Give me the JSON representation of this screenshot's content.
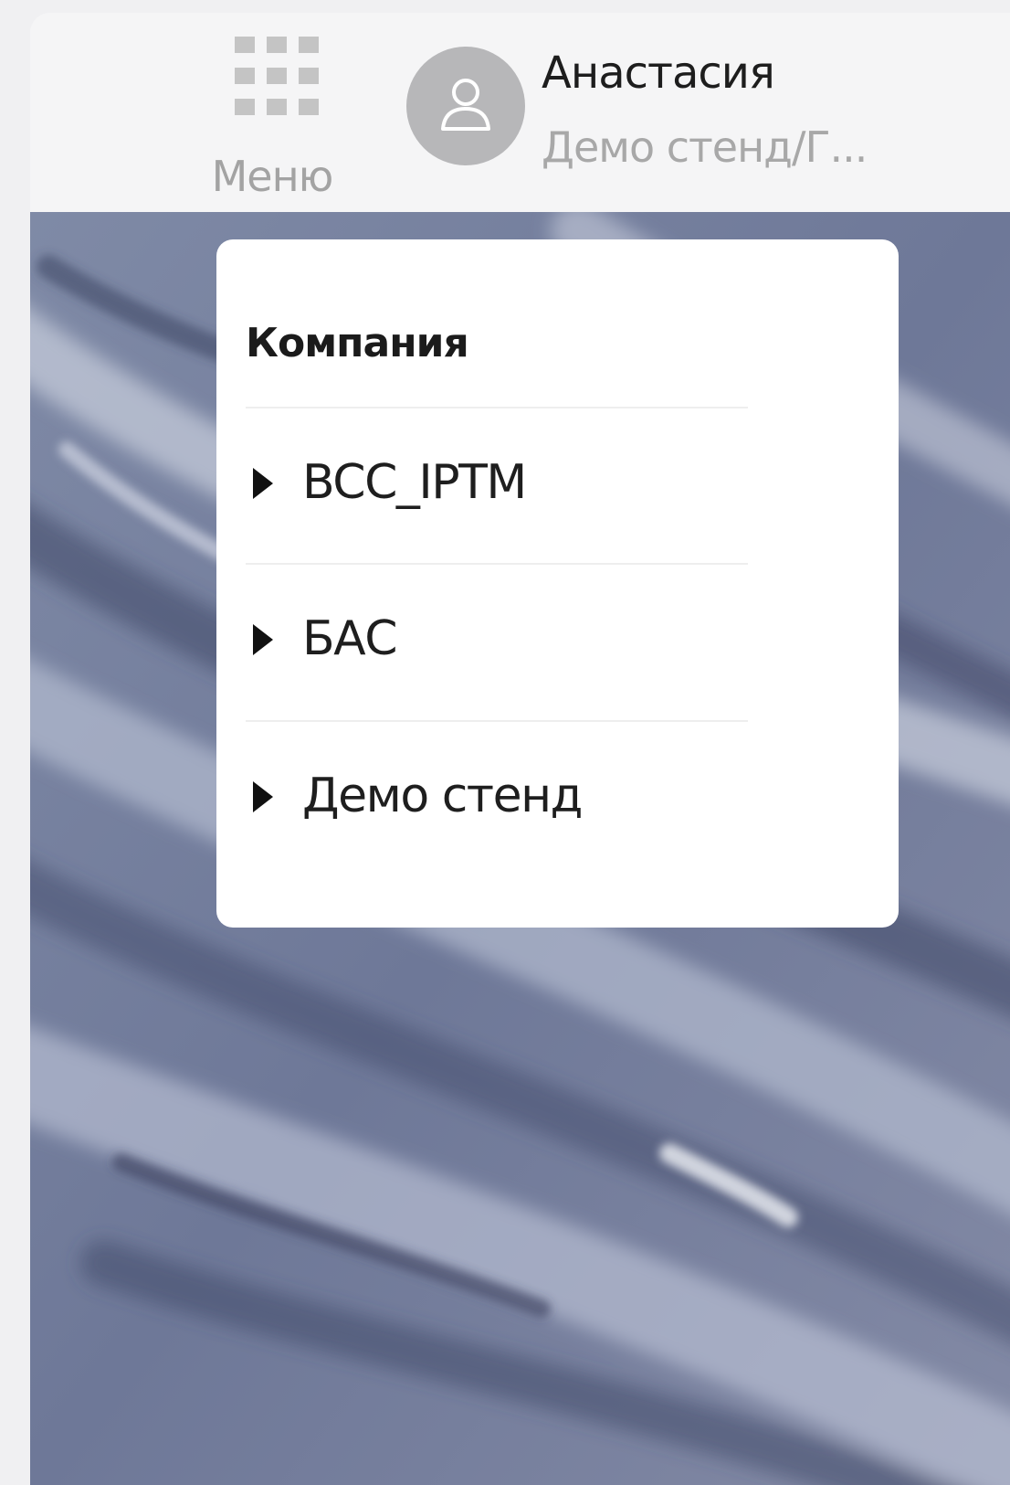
{
  "header": {
    "menu_label": "Меню",
    "menu_icon": "grid-icon",
    "user_name": "Анастасия",
    "user_org": "Демо стенд/Г...",
    "avatar_icon": "user-icon"
  },
  "dropdown": {
    "title": "Компания",
    "items": [
      {
        "label": "BCC_IPTM",
        "icon": "caret-right-icon"
      },
      {
        "label": "БАС",
        "icon": "caret-right-icon"
      },
      {
        "label": "Демо стенд",
        "icon": "caret-right-icon"
      }
    ]
  },
  "colors": {
    "page_bg": "#f0f0f2",
    "topbar_bg": "#f5f5f6",
    "avatar_bg": "#b7b7b9",
    "map_base": "#6f7a98"
  }
}
